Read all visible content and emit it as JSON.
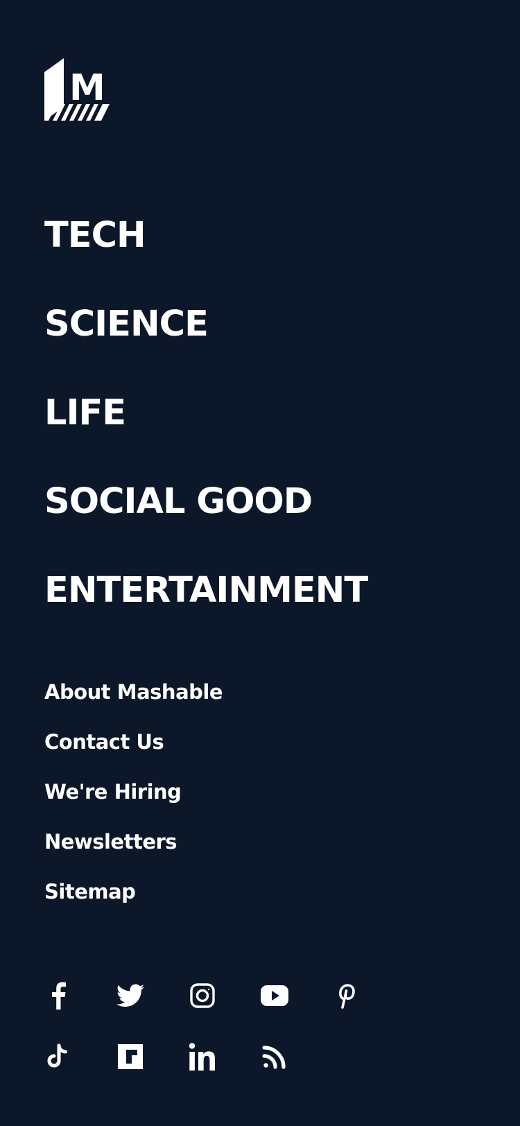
{
  "brand": {
    "logo_letter": "M",
    "logo_icon": "mashable-logo-icon"
  },
  "nav": {
    "sections": [
      "TECH",
      "SCIENCE",
      "LIFE",
      "SOCIAL GOOD",
      "ENTERTAINMENT"
    ],
    "links": [
      "About Mashable",
      "Contact Us",
      "We're Hiring",
      "Newsletters",
      "Sitemap"
    ]
  },
  "social": {
    "row1": [
      "facebook-icon",
      "twitter-icon",
      "instagram-icon",
      "youtube-icon",
      "pinterest-icon"
    ],
    "row2": [
      "tiktok-icon",
      "flipboard-icon",
      "linkedin-icon",
      "rss-icon"
    ]
  },
  "colors": {
    "background": "#0c1729",
    "foreground": "#ffffff"
  }
}
